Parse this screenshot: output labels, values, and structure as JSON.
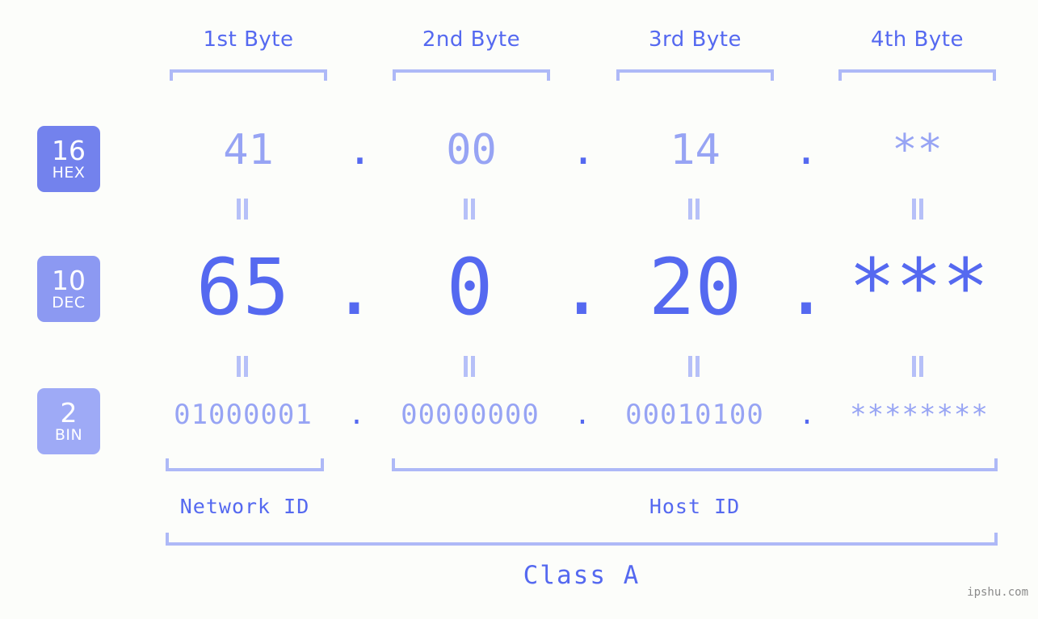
{
  "watermark": "ipshu.com",
  "colors": {
    "background": "#fcfdfa",
    "accent_strong": "#5569f0",
    "accent_mid": "#97a4f4",
    "accent_light": "#aeb9f7",
    "badge_hex": "#7382ed",
    "badge_dec": "#8c99f2",
    "badge_bin": "#9eaaf6"
  },
  "byte_headers": [
    {
      "label": "1st Byte"
    },
    {
      "label": "2nd Byte"
    },
    {
      "label": "3rd Byte"
    },
    {
      "label": "4th Byte"
    }
  ],
  "radix_badges": [
    {
      "num": "16",
      "sub": "HEX"
    },
    {
      "num": "10",
      "sub": "DEC"
    },
    {
      "num": "2",
      "sub": "BIN"
    }
  ],
  "rows": {
    "hex": {
      "values": [
        "41",
        "00",
        "14",
        "**"
      ],
      "separators": [
        ".",
        ".",
        "."
      ]
    },
    "dec": {
      "values": [
        "65",
        "0",
        "20",
        "***"
      ],
      "separators": [
        ".",
        ".",
        "."
      ]
    },
    "bin": {
      "values": [
        "01000001",
        "00000000",
        "00010100",
        "********"
      ],
      "separators": [
        ".",
        ".",
        "."
      ]
    }
  },
  "equals_markers": {
    "glyph": "=",
    "count_per_row": 4
  },
  "id_sections": [
    {
      "label": "Network ID"
    },
    {
      "label": "Host ID"
    }
  ],
  "class_section": {
    "label": "Class A"
  }
}
